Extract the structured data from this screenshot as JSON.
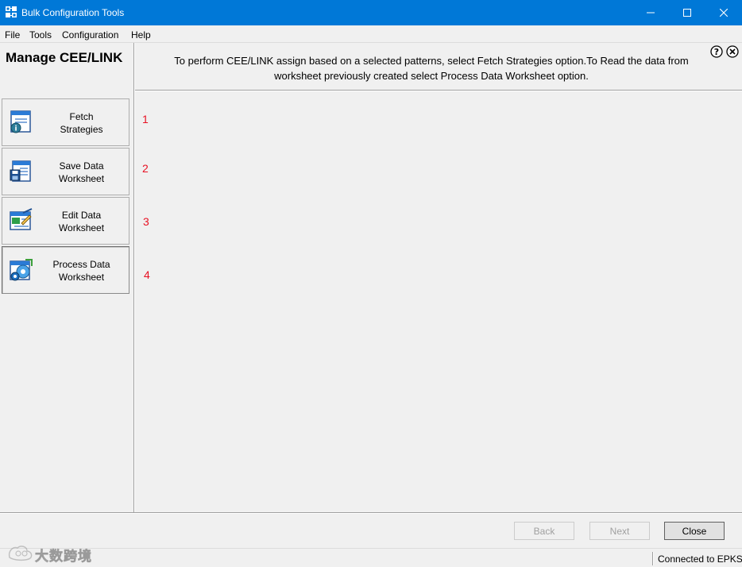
{
  "window": {
    "title": "Bulk Configuration Tools",
    "minimize_icon": "minimize-icon",
    "maximize_icon": "maximize-icon",
    "close_icon": "close-icon"
  },
  "menu": {
    "items": [
      "File",
      "Tools",
      "Configuration",
      "Help"
    ]
  },
  "left_panel": {
    "title": "Manage CEE/LINK",
    "actions": [
      {
        "line1": "Fetch",
        "line2": "Strategies",
        "icon": "fetch-strategies-icon"
      },
      {
        "line1": "Save Data",
        "line2": "Worksheet",
        "icon": "save-worksheet-icon"
      },
      {
        "line1": "Edit Data",
        "line2": "Worksheet",
        "icon": "edit-worksheet-icon"
      },
      {
        "line1": "Process Data",
        "line2": "Worksheet",
        "icon": "process-worksheet-icon"
      }
    ]
  },
  "header": {
    "instructions_line1": "To perform CEE/LINK assign based on a selected patterns, select Fetch Strategies option.To Read the data from",
    "instructions_line2": "worksheet previously created select Process Data Worksheet option.",
    "help_icon": "help-icon",
    "close_icon": "close-panel-icon"
  },
  "annotations": [
    "1",
    "2",
    "3",
    "4"
  ],
  "footer": {
    "back_label": "Back",
    "next_label": "Next",
    "close_label": "Close"
  },
  "status": {
    "connection": "Connected to EPKS"
  },
  "watermark": {
    "text": "大数跨境"
  },
  "colors": {
    "titlebar": "#0078d7",
    "annotation": "#e81123"
  }
}
